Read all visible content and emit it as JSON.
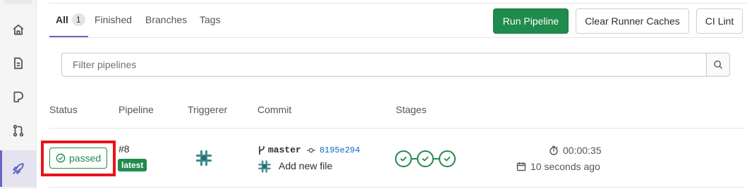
{
  "colors": {
    "primary_green": "#1f8b4c",
    "highlight_red": "#e8141b",
    "accent_purple": "#6666c4",
    "link_blue": "#1068bf"
  },
  "sidebar": {
    "items": [
      {
        "icon": "home-icon"
      },
      {
        "icon": "file-icon"
      },
      {
        "icon": "issues-icon"
      },
      {
        "icon": "merge-request-icon"
      },
      {
        "icon": "rocket-icon",
        "active": true
      }
    ]
  },
  "tabs": [
    {
      "label": "All",
      "count": "1",
      "active": true
    },
    {
      "label": "Finished"
    },
    {
      "label": "Branches"
    },
    {
      "label": "Tags"
    }
  ],
  "actions": {
    "run_pipeline": "Run Pipeline",
    "clear_runner_caches": "Clear Runner Caches",
    "ci_lint": "CI Lint"
  },
  "filter": {
    "placeholder": "Filter pipelines",
    "search_icon": "search-icon"
  },
  "table": {
    "headers": [
      "Status",
      "Pipeline",
      "Triggerer",
      "Commit",
      "Stages"
    ],
    "rows": [
      {
        "status": "passed",
        "pipeline_id": "#8",
        "tag": "latest",
        "branch": "master",
        "sha": "8195e294",
        "commit_title": "Add new file",
        "stages": [
          "passed",
          "passed",
          "passed"
        ],
        "duration": "00:00:35",
        "finished": "10 seconds ago"
      }
    ]
  }
}
